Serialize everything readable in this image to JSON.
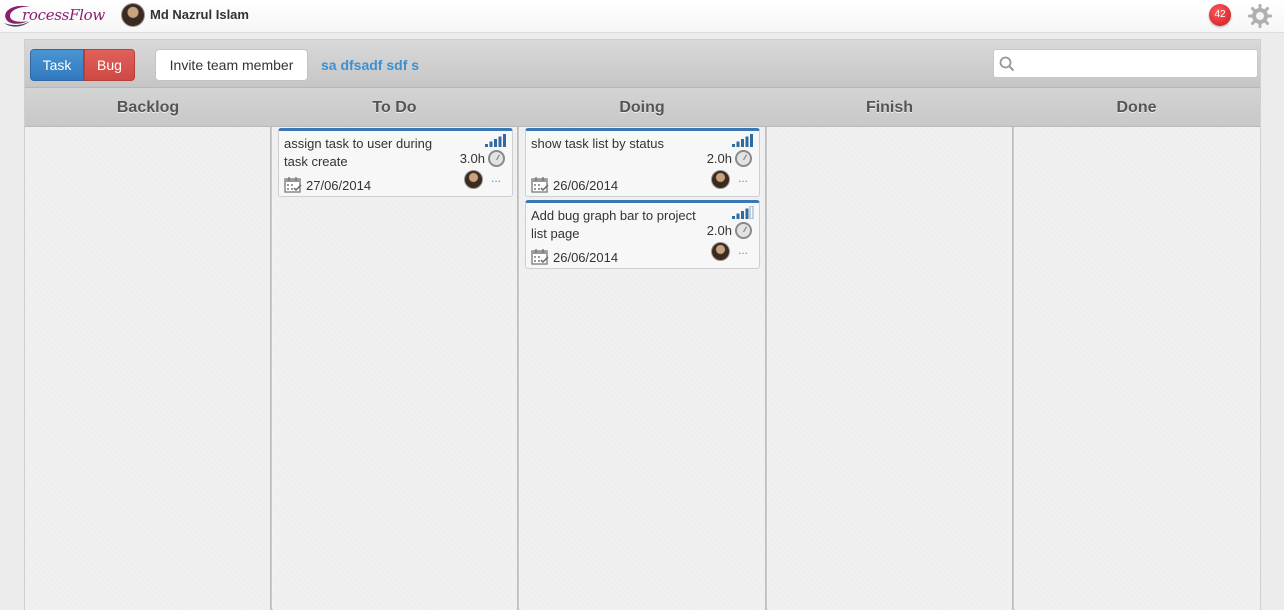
{
  "app": {
    "logo_text": "rocessFlow",
    "user_name": "Md Nazrul Islam",
    "notification_count": "42"
  },
  "toolbar": {
    "task_label": "Task",
    "bug_label": "Bug",
    "invite_label": "Invite team member",
    "project_name": "sa dfsadf sdf s",
    "search_placeholder": "",
    "search_value": ""
  },
  "columns": [
    {
      "title": "Backlog"
    },
    {
      "title": "To Do"
    },
    {
      "title": "Doing"
    },
    {
      "title": "Finish"
    },
    {
      "title": "Done"
    }
  ],
  "cards": [
    {
      "column": "To Do",
      "title": "assign task to user during task create",
      "hours": "3.0h",
      "date": "27/06/2014",
      "priority_level": 5,
      "more": "..."
    },
    {
      "column": "Doing",
      "title": "show task list by status",
      "hours": "2.0h",
      "date": "26/06/2014",
      "priority_level": 5,
      "more": "..."
    },
    {
      "column": "Doing",
      "title": "Add bug graph bar to project list page",
      "hours": "2.0h",
      "date": "26/06/2014",
      "priority_level": 4,
      "more": "..."
    }
  ],
  "colors": {
    "task_blue": "#3a86c8",
    "bug_red": "#d9534f",
    "card_accent": "#3a77b5",
    "link_blue": "#3d8fcf",
    "badge_red": "#d9252a"
  },
  "icons": [
    "logo-swoosh-icon",
    "user-avatar",
    "notification-badge",
    "gear-icon",
    "search-icon",
    "signal-bars-icon",
    "clock-icon",
    "calendar-icon",
    "more-icon"
  ]
}
